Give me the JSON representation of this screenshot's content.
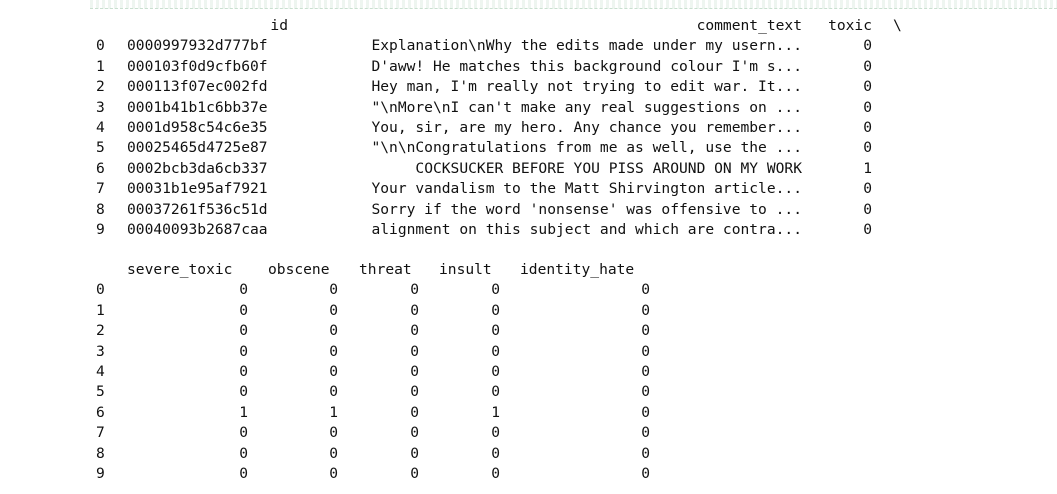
{
  "output_block_1": {
    "headers": {
      "id": "id",
      "comment_text": "comment_text",
      "toxic": "toxic",
      "continuation": "\\"
    },
    "rows": [
      {
        "index": "0",
        "id": "0000997932d777bf",
        "comment_text": "Explanation\\nWhy the edits made under my usern...",
        "toxic": "0"
      },
      {
        "index": "1",
        "id": "000103f0d9cfb60f",
        "comment_text": "D'aww! He matches this background colour I'm s...",
        "toxic": "0"
      },
      {
        "index": "2",
        "id": "000113f07ec002fd",
        "comment_text": "Hey man, I'm really not trying to edit war. It...",
        "toxic": "0"
      },
      {
        "index": "3",
        "id": "0001b41b1c6bb37e",
        "comment_text": "\"\\nMore\\nI can't make any real suggestions on ...",
        "toxic": "0"
      },
      {
        "index": "4",
        "id": "0001d958c54c6e35",
        "comment_text": "You, sir, are my hero. Any chance you remember...",
        "toxic": "0"
      },
      {
        "index": "5",
        "id": "00025465d4725e87",
        "comment_text": "\"\\n\\nCongratulations from me as well, use the ...",
        "toxic": "0"
      },
      {
        "index": "6",
        "id": "0002bcb3da6cb337",
        "comment_text": "COCKSUCKER BEFORE YOU PISS AROUND ON MY WORK",
        "toxic": "1"
      },
      {
        "index": "7",
        "id": "00031b1e95af7921",
        "comment_text": "Your vandalism to the Matt Shirvington article...",
        "toxic": "0"
      },
      {
        "index": "8",
        "id": "00037261f536c51d",
        "comment_text": "Sorry if the word 'nonsense' was offensive to ...",
        "toxic": "0"
      },
      {
        "index": "9",
        "id": "00040093b2687caa",
        "comment_text": "alignment on this subject and which are contra...",
        "toxic": "0"
      }
    ]
  },
  "output_block_2": {
    "headers": {
      "severe_toxic": "severe_toxic",
      "obscene": "obscene",
      "threat": "threat",
      "insult": "insult",
      "identity_hate": "identity_hate"
    },
    "rows": [
      {
        "index": "0",
        "severe_toxic": "0",
        "obscene": "0",
        "threat": "0",
        "insult": "0",
        "identity_hate": "0"
      },
      {
        "index": "1",
        "severe_toxic": "0",
        "obscene": "0",
        "threat": "0",
        "insult": "0",
        "identity_hate": "0"
      },
      {
        "index": "2",
        "severe_toxic": "0",
        "obscene": "0",
        "threat": "0",
        "insult": "0",
        "identity_hate": "0"
      },
      {
        "index": "3",
        "severe_toxic": "0",
        "obscene": "0",
        "threat": "0",
        "insult": "0",
        "identity_hate": "0"
      },
      {
        "index": "4",
        "severe_toxic": "0",
        "obscene": "0",
        "threat": "0",
        "insult": "0",
        "identity_hate": "0"
      },
      {
        "index": "5",
        "severe_toxic": "0",
        "obscene": "0",
        "threat": "0",
        "insult": "0",
        "identity_hate": "0"
      },
      {
        "index": "6",
        "severe_toxic": "1",
        "obscene": "1",
        "threat": "0",
        "insult": "1",
        "identity_hate": "0"
      },
      {
        "index": "7",
        "severe_toxic": "0",
        "obscene": "0",
        "threat": "0",
        "insult": "0",
        "identity_hate": "0"
      },
      {
        "index": "8",
        "severe_toxic": "0",
        "obscene": "0",
        "threat": "0",
        "insult": "0",
        "identity_hate": "0"
      },
      {
        "index": "9",
        "severe_toxic": "0",
        "obscene": "0",
        "threat": "0",
        "insult": "0",
        "identity_hate": "0"
      }
    ]
  }
}
